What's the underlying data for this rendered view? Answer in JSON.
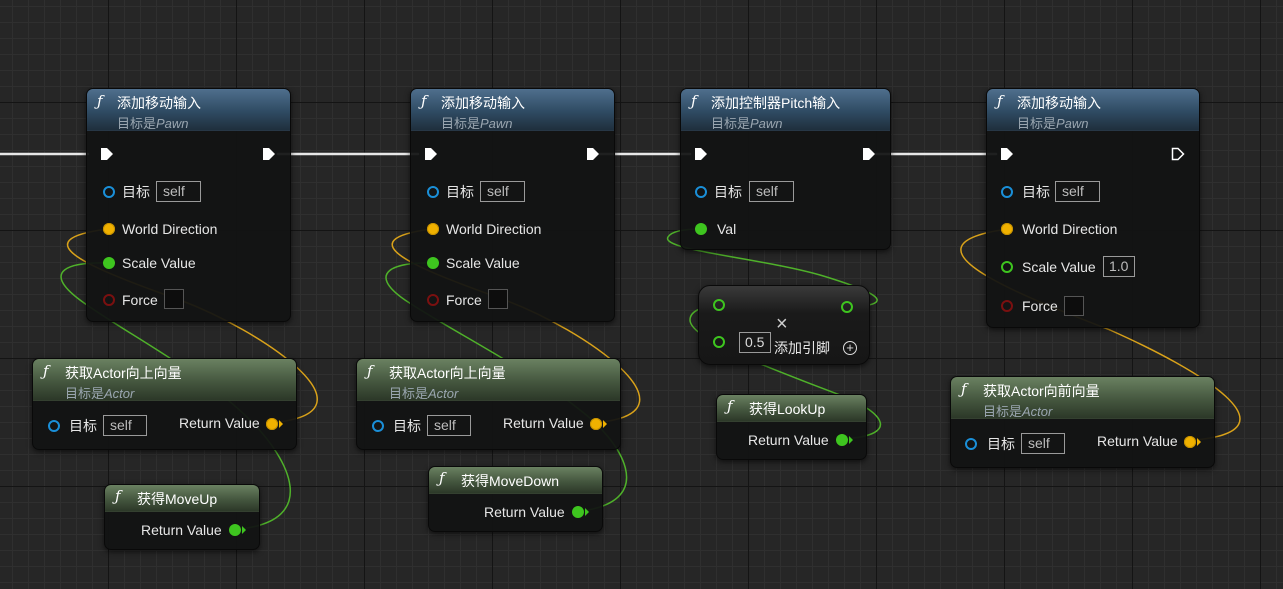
{
  "nodes": {
    "add_move_1": {
      "func_icon": "ƒ",
      "title": "添加移动输入",
      "target_prefix": "目标是",
      "target_class": "Pawn",
      "pins": {
        "target": "目标",
        "target_value": "self",
        "world_direction": "World Direction",
        "scale_value": "Scale Value",
        "force": "Force"
      }
    },
    "add_move_2": {
      "func_icon": "ƒ",
      "title": "添加移动输入",
      "target_prefix": "目标是",
      "target_class": "Pawn",
      "pins": {
        "target": "目标",
        "target_value": "self",
        "world_direction": "World Direction",
        "scale_value": "Scale Value",
        "force": "Force"
      }
    },
    "add_pitch": {
      "func_icon": "ƒ",
      "title": "添加控制器Pitch输入",
      "target_prefix": "目标是",
      "target_class": "Pawn",
      "pins": {
        "target": "目标",
        "target_value": "self",
        "val": "Val"
      }
    },
    "add_move_3": {
      "func_icon": "ƒ",
      "title": "添加移动输入",
      "target_prefix": "目标是",
      "target_class": "Pawn",
      "pins": {
        "target": "目标",
        "target_value": "self",
        "world_direction": "World Direction",
        "scale_value": "Scale Value",
        "scale_default": "1.0",
        "force": "Force"
      }
    },
    "get_up_1": {
      "func_icon": "ƒ",
      "title": "获取Actor向上向量",
      "target_prefix": "目标是",
      "target_class": "Actor",
      "pins": {
        "target": "目标",
        "target_value": "self",
        "return": "Return Value"
      }
    },
    "get_up_2": {
      "func_icon": "ƒ",
      "title": "获取Actor向上向量",
      "target_prefix": "目标是",
      "target_class": "Actor",
      "pins": {
        "target": "目标",
        "target_value": "self",
        "return": "Return Value"
      }
    },
    "get_forward": {
      "func_icon": "ƒ",
      "title": "获取Actor向前向量",
      "target_prefix": "目标是",
      "target_class": "Actor",
      "pins": {
        "target": "目标",
        "target_value": "self",
        "return": "Return Value"
      }
    },
    "get_moveup": {
      "func_icon": "ƒ",
      "title": "获得MoveUp",
      "pins": {
        "return": "Return Value"
      }
    },
    "get_movedown": {
      "func_icon": "ƒ",
      "title": "获得MoveDown",
      "pins": {
        "return": "Return Value"
      }
    },
    "get_lookup": {
      "func_icon": "ƒ",
      "title": "获得LookUp",
      "pins": {
        "return": "Return Value"
      }
    },
    "multiply": {
      "symbol": "×",
      "operand": "0.5",
      "add_pin": "添加引脚"
    }
  },
  "colors": {
    "exec": "#ffffff",
    "object_pin": "#1a8fd8",
    "vector_pin": "#f0b100",
    "float_pin": "#3ec51f",
    "bool_pin": "#7a1010",
    "header_function": "#3d5a74",
    "header_pure": "#55694d",
    "background": "#262626"
  }
}
